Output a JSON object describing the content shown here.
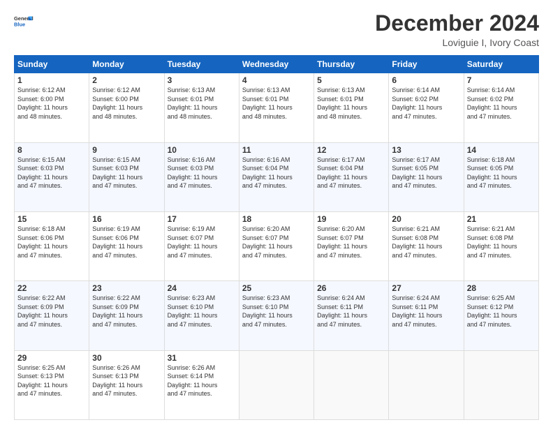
{
  "header": {
    "logo_line1": "General",
    "logo_line2": "Blue",
    "title": "December 2024",
    "subtitle": "Loviguie I, Ivory Coast"
  },
  "calendar": {
    "days_of_week": [
      "Sunday",
      "Monday",
      "Tuesday",
      "Wednesday",
      "Thursday",
      "Friday",
      "Saturday"
    ],
    "weeks": [
      [
        {
          "day": "1",
          "sunrise": "6:12 AM",
          "sunset": "6:00 PM",
          "daylight": "11 hours and 48 minutes."
        },
        {
          "day": "2",
          "sunrise": "6:12 AM",
          "sunset": "6:00 PM",
          "daylight": "11 hours and 48 minutes."
        },
        {
          "day": "3",
          "sunrise": "6:13 AM",
          "sunset": "6:01 PM",
          "daylight": "11 hours and 48 minutes."
        },
        {
          "day": "4",
          "sunrise": "6:13 AM",
          "sunset": "6:01 PM",
          "daylight": "11 hours and 48 minutes."
        },
        {
          "day": "5",
          "sunrise": "6:13 AM",
          "sunset": "6:01 PM",
          "daylight": "11 hours and 48 minutes."
        },
        {
          "day": "6",
          "sunrise": "6:14 AM",
          "sunset": "6:02 PM",
          "daylight": "11 hours and 47 minutes."
        },
        {
          "day": "7",
          "sunrise": "6:14 AM",
          "sunset": "6:02 PM",
          "daylight": "11 hours and 47 minutes."
        }
      ],
      [
        {
          "day": "8",
          "sunrise": "6:15 AM",
          "sunset": "6:03 PM",
          "daylight": "11 hours and 47 minutes."
        },
        {
          "day": "9",
          "sunrise": "6:15 AM",
          "sunset": "6:03 PM",
          "daylight": "11 hours and 47 minutes."
        },
        {
          "day": "10",
          "sunrise": "6:16 AM",
          "sunset": "6:03 PM",
          "daylight": "11 hours and 47 minutes."
        },
        {
          "day": "11",
          "sunrise": "6:16 AM",
          "sunset": "6:04 PM",
          "daylight": "11 hours and 47 minutes."
        },
        {
          "day": "12",
          "sunrise": "6:17 AM",
          "sunset": "6:04 PM",
          "daylight": "11 hours and 47 minutes."
        },
        {
          "day": "13",
          "sunrise": "6:17 AM",
          "sunset": "6:05 PM",
          "daylight": "11 hours and 47 minutes."
        },
        {
          "day": "14",
          "sunrise": "6:18 AM",
          "sunset": "6:05 PM",
          "daylight": "11 hours and 47 minutes."
        }
      ],
      [
        {
          "day": "15",
          "sunrise": "6:18 AM",
          "sunset": "6:06 PM",
          "daylight": "11 hours and 47 minutes."
        },
        {
          "day": "16",
          "sunrise": "6:19 AM",
          "sunset": "6:06 PM",
          "daylight": "11 hours and 47 minutes."
        },
        {
          "day": "17",
          "sunrise": "6:19 AM",
          "sunset": "6:07 PM",
          "daylight": "11 hours and 47 minutes."
        },
        {
          "day": "18",
          "sunrise": "6:20 AM",
          "sunset": "6:07 PM",
          "daylight": "11 hours and 47 minutes."
        },
        {
          "day": "19",
          "sunrise": "6:20 AM",
          "sunset": "6:07 PM",
          "daylight": "11 hours and 47 minutes."
        },
        {
          "day": "20",
          "sunrise": "6:21 AM",
          "sunset": "6:08 PM",
          "daylight": "11 hours and 47 minutes."
        },
        {
          "day": "21",
          "sunrise": "6:21 AM",
          "sunset": "6:08 PM",
          "daylight": "11 hours and 47 minutes."
        }
      ],
      [
        {
          "day": "22",
          "sunrise": "6:22 AM",
          "sunset": "6:09 PM",
          "daylight": "11 hours and 47 minutes."
        },
        {
          "day": "23",
          "sunrise": "6:22 AM",
          "sunset": "6:09 PM",
          "daylight": "11 hours and 47 minutes."
        },
        {
          "day": "24",
          "sunrise": "6:23 AM",
          "sunset": "6:10 PM",
          "daylight": "11 hours and 47 minutes."
        },
        {
          "day": "25",
          "sunrise": "6:23 AM",
          "sunset": "6:10 PM",
          "daylight": "11 hours and 47 minutes."
        },
        {
          "day": "26",
          "sunrise": "6:24 AM",
          "sunset": "6:11 PM",
          "daylight": "11 hours and 47 minutes."
        },
        {
          "day": "27",
          "sunrise": "6:24 AM",
          "sunset": "6:11 PM",
          "daylight": "11 hours and 47 minutes."
        },
        {
          "day": "28",
          "sunrise": "6:25 AM",
          "sunset": "6:12 PM",
          "daylight": "11 hours and 47 minutes."
        }
      ],
      [
        {
          "day": "29",
          "sunrise": "6:25 AM",
          "sunset": "6:13 PM",
          "daylight": "11 hours and 47 minutes."
        },
        {
          "day": "30",
          "sunrise": "6:26 AM",
          "sunset": "6:13 PM",
          "daylight": "11 hours and 47 minutes."
        },
        {
          "day": "31",
          "sunrise": "6:26 AM",
          "sunset": "6:14 PM",
          "daylight": "11 hours and 47 minutes."
        },
        null,
        null,
        null,
        null
      ]
    ]
  }
}
